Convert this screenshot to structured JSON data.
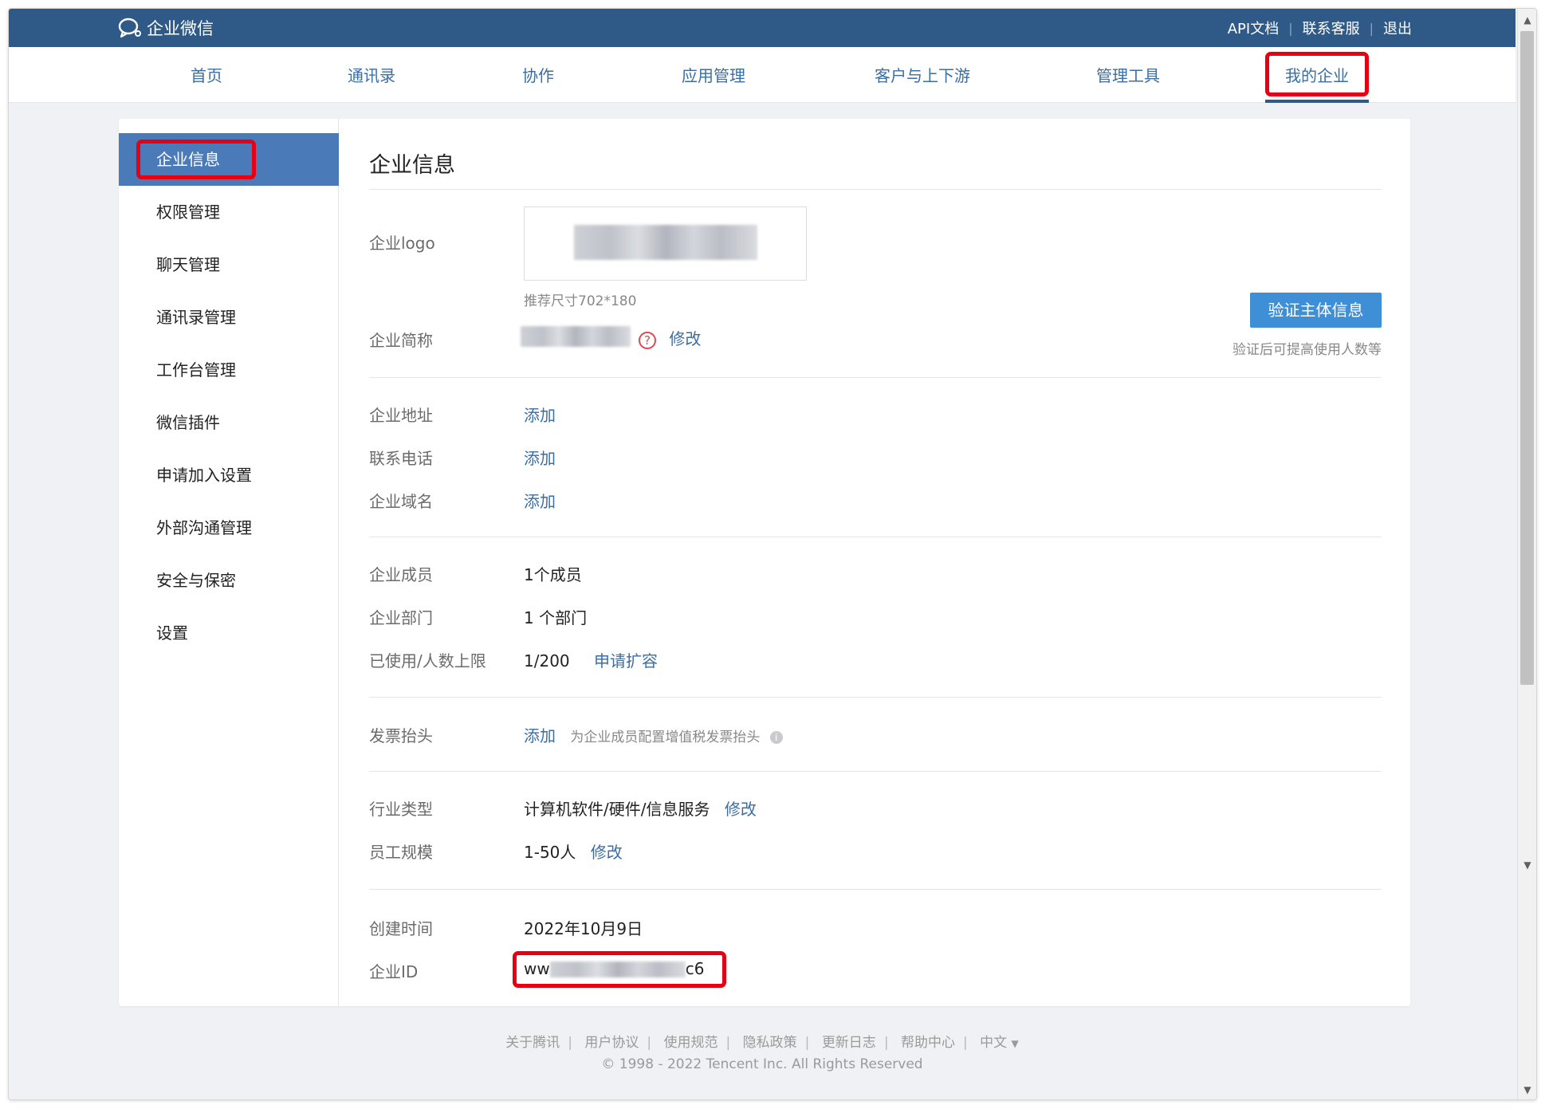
{
  "topbar": {
    "brand": "企业微信",
    "links": [
      "API文档",
      "联系客服",
      "退出"
    ]
  },
  "nav": {
    "items": [
      "首页",
      "通讯录",
      "协作",
      "应用管理",
      "客户与上下游",
      "管理工具",
      "我的企业"
    ],
    "active": "我的企业"
  },
  "sidebar": {
    "items": [
      "企业信息",
      "权限管理",
      "聊天管理",
      "通讯录管理",
      "工作台管理",
      "微信插件",
      "申请加入设置",
      "外部沟通管理",
      "安全与保密",
      "设置"
    ],
    "active": "企业信息"
  },
  "content": {
    "title": "企业信息",
    "logo": {
      "label": "企业logo",
      "hint": "推荐尺寸702*180"
    },
    "short_name": {
      "label": "企业简称",
      "edit": "修改"
    },
    "verify": {
      "button": "验证主体信息",
      "note": "验证后可提高使用人数等"
    },
    "address": {
      "label": "企业地址",
      "action": "添加"
    },
    "phone": {
      "label": "联系电话",
      "action": "添加"
    },
    "domain": {
      "label": "企业域名",
      "action": "添加"
    },
    "members": {
      "label": "企业成员",
      "value": "1个成员"
    },
    "departments": {
      "label": "企业部门",
      "value": "1 个部门"
    },
    "usage": {
      "label": "已使用/人数上限",
      "value": "1/200",
      "action": "申请扩容"
    },
    "invoice": {
      "label": "发票抬头",
      "action": "添加",
      "desc": "为企业成员配置增值税发票抬头"
    },
    "industry": {
      "label": "行业类型",
      "value": "计算机软件/硬件/信息服务",
      "edit": "修改"
    },
    "scale": {
      "label": "员工规模",
      "value": "1-50人",
      "edit": "修改"
    },
    "created": {
      "label": "创建时间",
      "value": "2022年10月9日"
    },
    "corp_id": {
      "label": "企业ID",
      "prefix": "ww",
      "suffix": "c6"
    }
  },
  "footer": {
    "links": [
      "关于腾讯",
      "用户协议",
      "使用规范",
      "隐私政策",
      "更新日志",
      "帮助中心"
    ],
    "language": "中文",
    "copyright": "© 1998 - 2022 Tencent Inc. All Rights Reserved"
  },
  "colors": {
    "topbar": "#2f5a88",
    "link": "#3a6ea5",
    "sidebar_active": "#4a7ab8",
    "primary_button": "#3e8fd6",
    "highlight": "#e60012"
  }
}
